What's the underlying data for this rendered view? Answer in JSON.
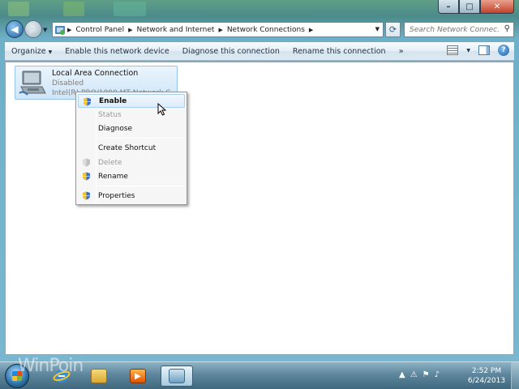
{
  "window": {
    "controls": {
      "minimize": "–",
      "maximize": "□",
      "close": "✕"
    }
  },
  "nav": {
    "back_glyph": "◀",
    "forward_glyph": "▶",
    "breadcrumbs": [
      "Control Panel",
      "Network and Internet",
      "Network Connections"
    ],
    "search_placeholder": "Search Network Connec..."
  },
  "commandbar": {
    "items": [
      "Organize",
      "Enable this network device",
      "Diagnose this connection",
      "Rename this connection"
    ],
    "more": "»",
    "help": "?"
  },
  "connection": {
    "name": "Local Area Connection",
    "status": "Disabled",
    "adapter": "Intel(R) PRO/1000 MT Network C"
  },
  "context_menu": {
    "items": [
      {
        "label": "Enable",
        "shield": true,
        "disabled": false,
        "bold": true,
        "hot": true
      },
      {
        "label": "Status",
        "shield": false,
        "disabled": true
      },
      {
        "label": "Diagnose",
        "shield": false,
        "disabled": false
      },
      {
        "label": "Create Shortcut",
        "shield": false,
        "disabled": false
      },
      {
        "label": "Delete",
        "shield": true,
        "disabled": true
      },
      {
        "label": "Rename",
        "shield": true,
        "disabled": false
      },
      {
        "label": "Properties",
        "shield": true,
        "disabled": false
      }
    ]
  },
  "taskbar": {
    "clock_time": "2:52 PM",
    "clock_date": "6/24/2013",
    "watermark": "WinPoin"
  },
  "colors": {
    "accent": "#1e5d9e",
    "selection": "#cfe6f8",
    "menu_hot": "#dcebfb"
  }
}
